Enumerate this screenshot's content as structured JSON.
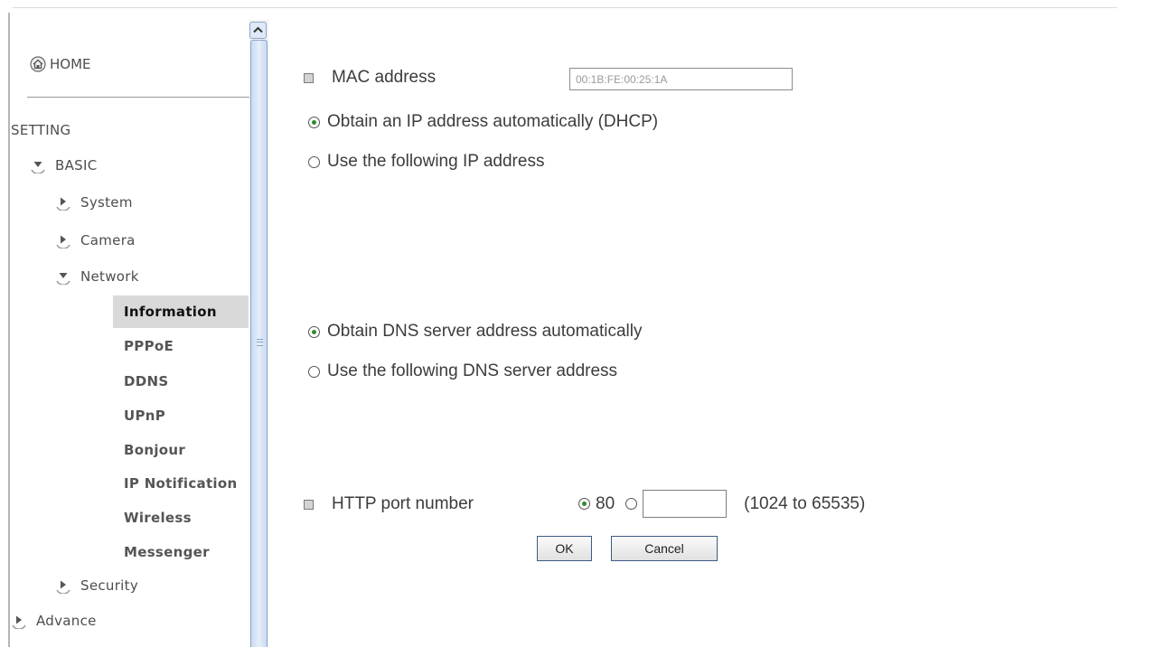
{
  "sidebar": {
    "home_label": "HOME",
    "section_label": "SETTING",
    "basic_label": "BASIC",
    "system_label": "System",
    "camera_label": "Camera",
    "network_label": "Network",
    "network_items": [
      {
        "label": "Information",
        "active": true
      },
      {
        "label": "PPPoE"
      },
      {
        "label": "DDNS"
      },
      {
        "label": "UPnP"
      },
      {
        "label": "Bonjour"
      },
      {
        "label": "IP Notification"
      },
      {
        "label": "Wireless"
      },
      {
        "label": "Messenger"
      }
    ],
    "security_label": "Security",
    "advance_label": "Advance"
  },
  "form": {
    "mac_label": "MAC address",
    "mac_value": "00:1B:FE:00:25:1A",
    "ip_auto_label": "Obtain an IP address automatically (DHCP)",
    "ip_manual_label": "Use the following IP address",
    "dns_auto_label": "Obtain DNS server address automatically",
    "dns_manual_label": "Use the following DNS server address",
    "http_port_label": "HTTP port number",
    "http_port_default": "80",
    "http_port_custom_value": "",
    "http_port_range": "(1024 to 65535)",
    "ok_label": "OK",
    "cancel_label": "Cancel"
  },
  "colors": {
    "radio_selected": "#2f8a2f",
    "active_item_bg": "#d9d9d9",
    "scrollbar_accent": "#8aa6c8"
  }
}
